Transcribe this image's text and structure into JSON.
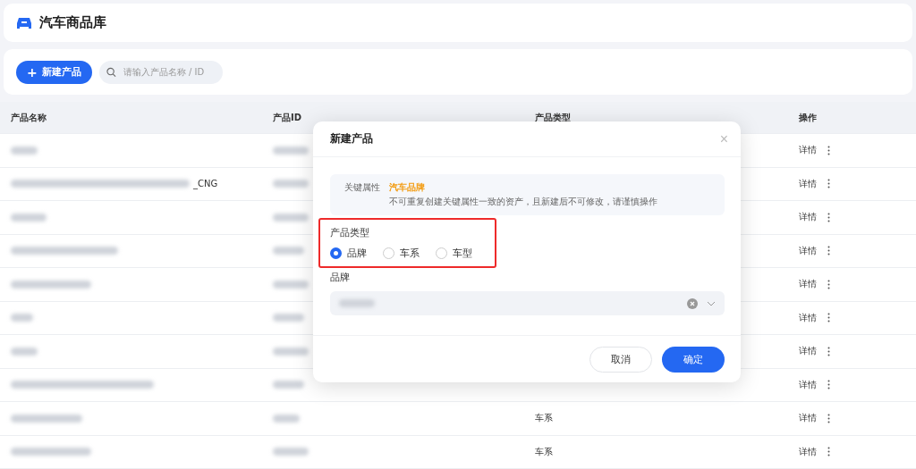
{
  "header": {
    "title": "汽车商品库"
  },
  "toolbar": {
    "new_button": "新建产品",
    "plus": "+",
    "search": {
      "placeholder": "请输入产品名称 / ID"
    }
  },
  "table": {
    "columns": [
      "产品名称",
      "产品ID",
      "产品类型",
      "操作"
    ],
    "rows": [
      {
        "name_tail": "",
        "type": "",
        "action": "详情"
      },
      {
        "name_tail": "_CNG",
        "type": "",
        "action": "详情"
      },
      {
        "name_tail": "",
        "type": "",
        "action": "详情"
      },
      {
        "name_tail": "",
        "type": "",
        "action": "详情"
      },
      {
        "name_tail": "",
        "type": "",
        "action": "详情"
      },
      {
        "name_tail": "",
        "type": "",
        "action": "详情"
      },
      {
        "name_tail": "",
        "type": "",
        "action": "详情"
      },
      {
        "name_tail": "",
        "type": "",
        "action": "详情"
      },
      {
        "name_tail": "",
        "type": "车系",
        "action": "详情"
      },
      {
        "name_tail": "",
        "type": "车系",
        "action": "详情"
      }
    ]
  },
  "dialog": {
    "title": "新建产品",
    "close": "×",
    "notice": {
      "label": "关键属性",
      "value": "汽车品牌",
      "text": "不可重复创建关键属性一致的资产，且新建后不可修改，请谨慎操作"
    },
    "type_field": {
      "label": "产品类型",
      "highlighted": true,
      "options": [
        {
          "label": "品牌",
          "selected": true
        },
        {
          "label": "车系",
          "selected": false
        },
        {
          "label": "车型",
          "selected": false
        }
      ]
    },
    "brand_field": {
      "label": "品牌"
    },
    "buttons": [
      {
        "label": "取消",
        "kind": "secondary"
      },
      {
        "label": "确定",
        "kind": "primary"
      }
    ]
  }
}
